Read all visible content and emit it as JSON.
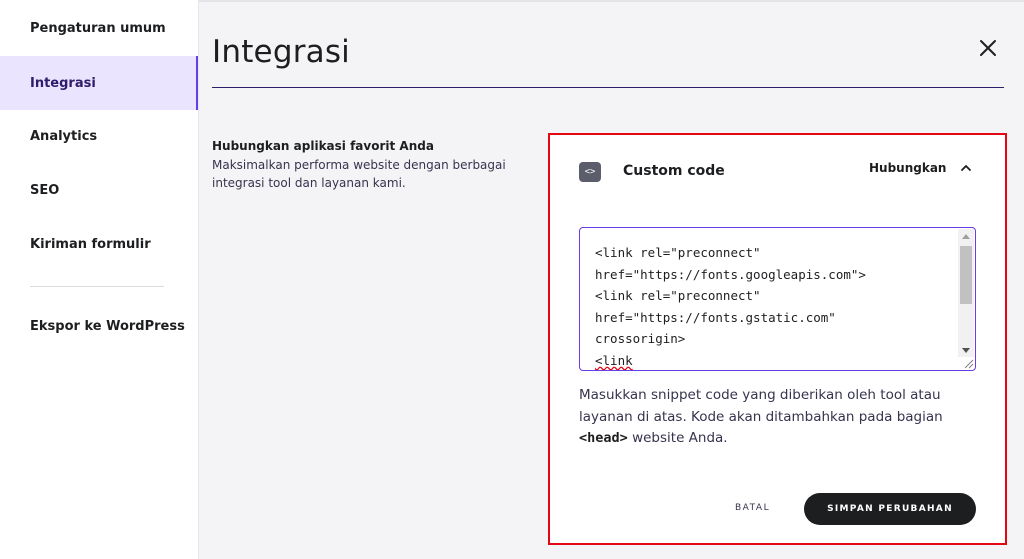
{
  "sidebar": {
    "items": [
      {
        "label": "Pengaturan umum",
        "active": false
      },
      {
        "label": "Integrasi",
        "active": true
      },
      {
        "label": "Analytics",
        "active": false
      },
      {
        "label": "SEO",
        "active": false
      },
      {
        "label": "Kiriman formulir",
        "active": false
      },
      {
        "label": "Ekspor ke WordPress",
        "active": false
      }
    ]
  },
  "header": {
    "title": "Integrasi",
    "close_icon": "close-icon"
  },
  "intro": {
    "title": "Hubungkan aplikasi favorit Anda",
    "description": "Maksimalkan performa website dengan berbagai integrasi tool dan layanan kami."
  },
  "card": {
    "icon": "code-icon",
    "icon_glyph": "<>",
    "title": "Custom code",
    "connect_label": "Hubungkan",
    "chevron_icon": "chevron-up-icon",
    "code_lines": [
      "<link rel=\"preconnect\"",
      "href=\"https://fonts.googleapis.com\">",
      "<link rel=\"preconnect\"",
      "href=\"https://fonts.gstatic.com\"",
      "crossorigin>",
      "<link"
    ],
    "help_prefix": "Masukkan snippet code yang diberikan oleh tool atau layanan di atas. Kode akan ditambahkan pada bagian ",
    "help_code": "<head>",
    "help_suffix": " website Anda.",
    "cancel_label": "BATAL",
    "save_label": "SIMPAN PERUBAHAN",
    "highlight_color": "#e30613",
    "accent_color": "#673de6"
  }
}
